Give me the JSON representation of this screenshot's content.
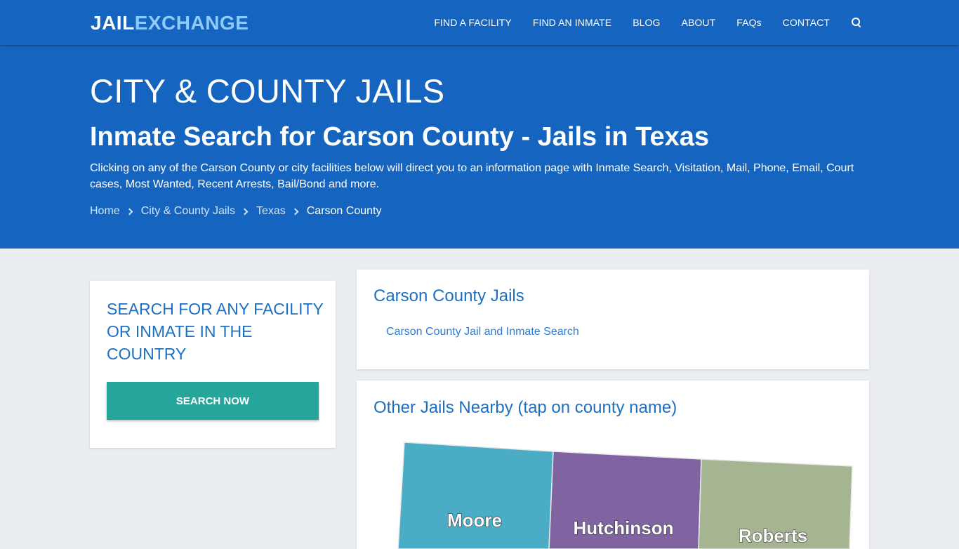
{
  "header": {
    "logo": {
      "part1": "JAIL",
      "part2": "EXCHANGE"
    },
    "nav": [
      {
        "label": "FIND A FACILITY"
      },
      {
        "label": "FIND AN INMATE"
      },
      {
        "label": "BLOG"
      },
      {
        "label": "ABOUT"
      },
      {
        "label": "FAQs"
      },
      {
        "label": "CONTACT"
      }
    ],
    "search_icon": "search-icon"
  },
  "hero": {
    "title": "CITY & COUNTY JAILS",
    "subtitle": "Inmate Search for Carson County - Jails in Texas",
    "description": "Clicking on any of the Carson County or city facilities below will direct you to an information page with Inmate Search, Visitation, Mail, Phone, Email, Court cases, Most Wanted, Recent Arrests, Bail/Bond and more.",
    "breadcrumb": [
      {
        "label": "Home"
      },
      {
        "label": "City & County Jails"
      },
      {
        "label": "Texas"
      },
      {
        "label": "Carson County"
      }
    ]
  },
  "sidebar": {
    "title": "SEARCH FOR ANY FACILITY OR INMATE IN THE COUNTRY",
    "button_label": "SEARCH NOW"
  },
  "jails": {
    "title": "Carson County Jails",
    "links": [
      {
        "label": "Carson County Jail and Inmate Search"
      }
    ]
  },
  "nearby": {
    "title": "Other Jails Nearby (tap on county name)",
    "counties": [
      {
        "name": "Moore",
        "color": "#4bacc6"
      },
      {
        "name": "Hutchinson",
        "color": "#8064a2"
      },
      {
        "name": "Roberts",
        "color": "#a5b592"
      }
    ]
  },
  "colors": {
    "primary": "#1565c0",
    "accent_link": "#90caf9",
    "button": "#26a69a",
    "card_title": "#1e6fc1"
  }
}
